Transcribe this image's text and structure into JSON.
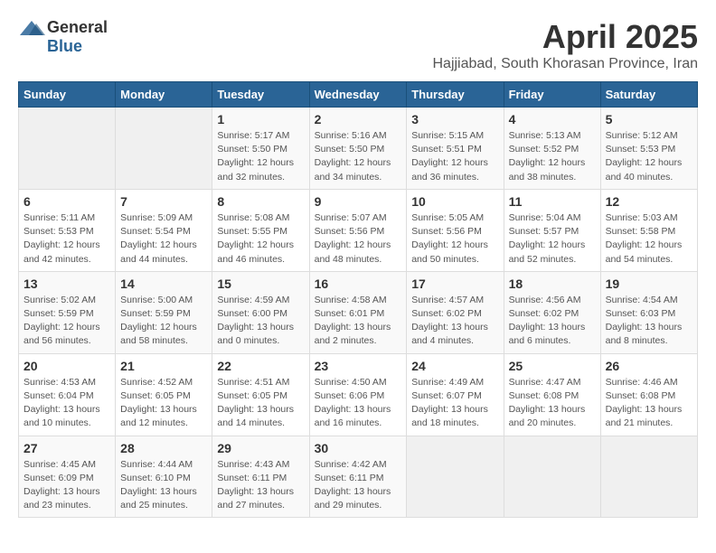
{
  "logo": {
    "general": "General",
    "blue": "Blue"
  },
  "title": "April 2025",
  "location": "Hajjiabad, South Khorasan Province, Iran",
  "days_header": [
    "Sunday",
    "Monday",
    "Tuesday",
    "Wednesday",
    "Thursday",
    "Friday",
    "Saturday"
  ],
  "weeks": [
    [
      {
        "day": "",
        "info": ""
      },
      {
        "day": "",
        "info": ""
      },
      {
        "day": "1",
        "info": "Sunrise: 5:17 AM\nSunset: 5:50 PM\nDaylight: 12 hours\nand 32 minutes."
      },
      {
        "day": "2",
        "info": "Sunrise: 5:16 AM\nSunset: 5:50 PM\nDaylight: 12 hours\nand 34 minutes."
      },
      {
        "day": "3",
        "info": "Sunrise: 5:15 AM\nSunset: 5:51 PM\nDaylight: 12 hours\nand 36 minutes."
      },
      {
        "day": "4",
        "info": "Sunrise: 5:13 AM\nSunset: 5:52 PM\nDaylight: 12 hours\nand 38 minutes."
      },
      {
        "day": "5",
        "info": "Sunrise: 5:12 AM\nSunset: 5:53 PM\nDaylight: 12 hours\nand 40 minutes."
      }
    ],
    [
      {
        "day": "6",
        "info": "Sunrise: 5:11 AM\nSunset: 5:53 PM\nDaylight: 12 hours\nand 42 minutes."
      },
      {
        "day": "7",
        "info": "Sunrise: 5:09 AM\nSunset: 5:54 PM\nDaylight: 12 hours\nand 44 minutes."
      },
      {
        "day": "8",
        "info": "Sunrise: 5:08 AM\nSunset: 5:55 PM\nDaylight: 12 hours\nand 46 minutes."
      },
      {
        "day": "9",
        "info": "Sunrise: 5:07 AM\nSunset: 5:56 PM\nDaylight: 12 hours\nand 48 minutes."
      },
      {
        "day": "10",
        "info": "Sunrise: 5:05 AM\nSunset: 5:56 PM\nDaylight: 12 hours\nand 50 minutes."
      },
      {
        "day": "11",
        "info": "Sunrise: 5:04 AM\nSunset: 5:57 PM\nDaylight: 12 hours\nand 52 minutes."
      },
      {
        "day": "12",
        "info": "Sunrise: 5:03 AM\nSunset: 5:58 PM\nDaylight: 12 hours\nand 54 minutes."
      }
    ],
    [
      {
        "day": "13",
        "info": "Sunrise: 5:02 AM\nSunset: 5:59 PM\nDaylight: 12 hours\nand 56 minutes."
      },
      {
        "day": "14",
        "info": "Sunrise: 5:00 AM\nSunset: 5:59 PM\nDaylight: 12 hours\nand 58 minutes."
      },
      {
        "day": "15",
        "info": "Sunrise: 4:59 AM\nSunset: 6:00 PM\nDaylight: 13 hours\nand 0 minutes."
      },
      {
        "day": "16",
        "info": "Sunrise: 4:58 AM\nSunset: 6:01 PM\nDaylight: 13 hours\nand 2 minutes."
      },
      {
        "day": "17",
        "info": "Sunrise: 4:57 AM\nSunset: 6:02 PM\nDaylight: 13 hours\nand 4 minutes."
      },
      {
        "day": "18",
        "info": "Sunrise: 4:56 AM\nSunset: 6:02 PM\nDaylight: 13 hours\nand 6 minutes."
      },
      {
        "day": "19",
        "info": "Sunrise: 4:54 AM\nSunset: 6:03 PM\nDaylight: 13 hours\nand 8 minutes."
      }
    ],
    [
      {
        "day": "20",
        "info": "Sunrise: 4:53 AM\nSunset: 6:04 PM\nDaylight: 13 hours\nand 10 minutes."
      },
      {
        "day": "21",
        "info": "Sunrise: 4:52 AM\nSunset: 6:05 PM\nDaylight: 13 hours\nand 12 minutes."
      },
      {
        "day": "22",
        "info": "Sunrise: 4:51 AM\nSunset: 6:05 PM\nDaylight: 13 hours\nand 14 minutes."
      },
      {
        "day": "23",
        "info": "Sunrise: 4:50 AM\nSunset: 6:06 PM\nDaylight: 13 hours\nand 16 minutes."
      },
      {
        "day": "24",
        "info": "Sunrise: 4:49 AM\nSunset: 6:07 PM\nDaylight: 13 hours\nand 18 minutes."
      },
      {
        "day": "25",
        "info": "Sunrise: 4:47 AM\nSunset: 6:08 PM\nDaylight: 13 hours\nand 20 minutes."
      },
      {
        "day": "26",
        "info": "Sunrise: 4:46 AM\nSunset: 6:08 PM\nDaylight: 13 hours\nand 21 minutes."
      }
    ],
    [
      {
        "day": "27",
        "info": "Sunrise: 4:45 AM\nSunset: 6:09 PM\nDaylight: 13 hours\nand 23 minutes."
      },
      {
        "day": "28",
        "info": "Sunrise: 4:44 AM\nSunset: 6:10 PM\nDaylight: 13 hours\nand 25 minutes."
      },
      {
        "day": "29",
        "info": "Sunrise: 4:43 AM\nSunset: 6:11 PM\nDaylight: 13 hours\nand 27 minutes."
      },
      {
        "day": "30",
        "info": "Sunrise: 4:42 AM\nSunset: 6:11 PM\nDaylight: 13 hours\nand 29 minutes."
      },
      {
        "day": "",
        "info": ""
      },
      {
        "day": "",
        "info": ""
      },
      {
        "day": "",
        "info": ""
      }
    ]
  ]
}
